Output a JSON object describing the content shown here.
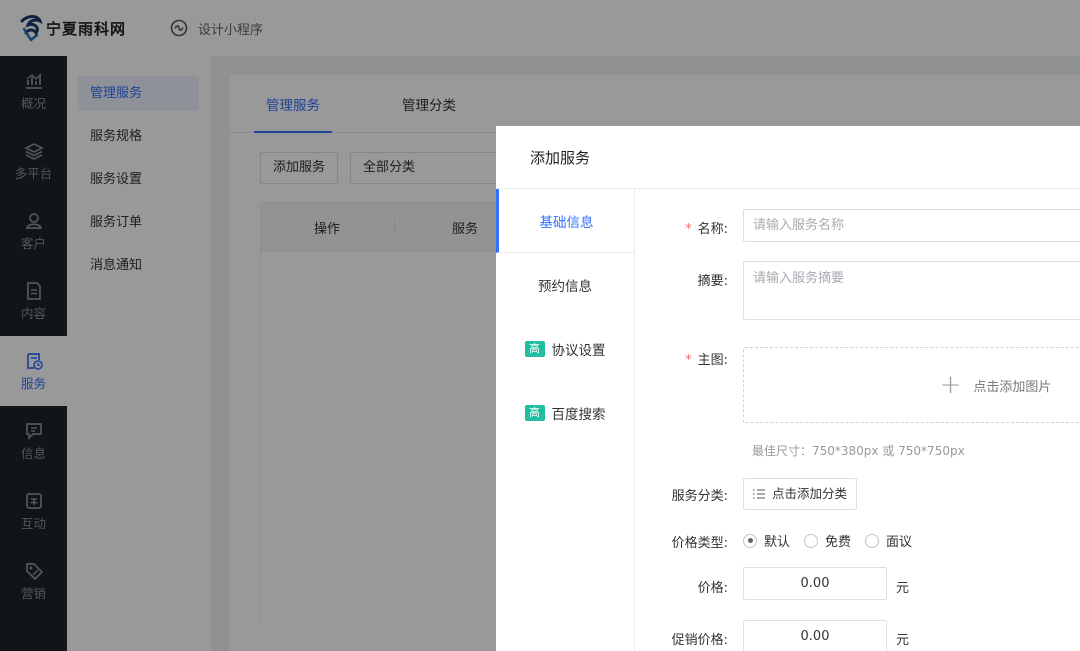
{
  "header": {
    "brand": "宁夏雨科网",
    "mini_program": "设计小程序"
  },
  "rail": [
    {
      "label": "概况",
      "icon": "chart-icon"
    },
    {
      "label": "多平台",
      "icon": "layers-icon"
    },
    {
      "label": "客户",
      "icon": "user-icon"
    },
    {
      "label": "内容",
      "icon": "document-icon"
    },
    {
      "label": "服务",
      "icon": "service-clock-icon",
      "active": true
    },
    {
      "label": "信息",
      "icon": "message-icon"
    },
    {
      "label": "互动",
      "icon": "interact-icon"
    },
    {
      "label": "营销",
      "icon": "tag-icon"
    }
  ],
  "submenu": [
    {
      "label": "管理服务",
      "active": true
    },
    {
      "label": "服务规格"
    },
    {
      "label": "服务设置"
    },
    {
      "label": "服务订单"
    },
    {
      "label": "消息通知"
    }
  ],
  "main": {
    "tabs": [
      {
        "label": "管理服务",
        "active": true
      },
      {
        "label": "管理分类"
      }
    ],
    "add_button": "添加服务",
    "category_select": "全部分类",
    "columns": [
      "操作",
      "服务"
    ]
  },
  "drawer": {
    "title": "添加服务",
    "nav": [
      {
        "label": "基础信息",
        "active": true
      },
      {
        "label": "预约信息"
      },
      {
        "label": "协议设置",
        "badge": "高"
      },
      {
        "label": "百度搜索",
        "badge": "高"
      }
    ],
    "form": {
      "name_label": "名称:",
      "name_placeholder": "请输入服务名称",
      "summary_label": "摘要:",
      "summary_placeholder": "请输入服务摘要",
      "image_label": "主图:",
      "image_upload": "点击添加图片",
      "image_hint": "最佳尺寸：750*380px 或 750*750px",
      "category_label": "服务分类:",
      "category_button": "点击添加分类",
      "price_type_label": "价格类型:",
      "price_types": [
        {
          "label": "默认",
          "checked": true
        },
        {
          "label": "免费"
        },
        {
          "label": "面议"
        }
      ],
      "price_label": "价格:",
      "price_value": "0.00",
      "price_unit": "元",
      "promo_label": "促销价格:",
      "promo_value": "0.00",
      "promo_unit": "元"
    }
  },
  "colors": {
    "accent": "#3370ff",
    "rail_bg": "#1f2329",
    "badge": "#1fbfa0",
    "required": "#f56c6c"
  }
}
